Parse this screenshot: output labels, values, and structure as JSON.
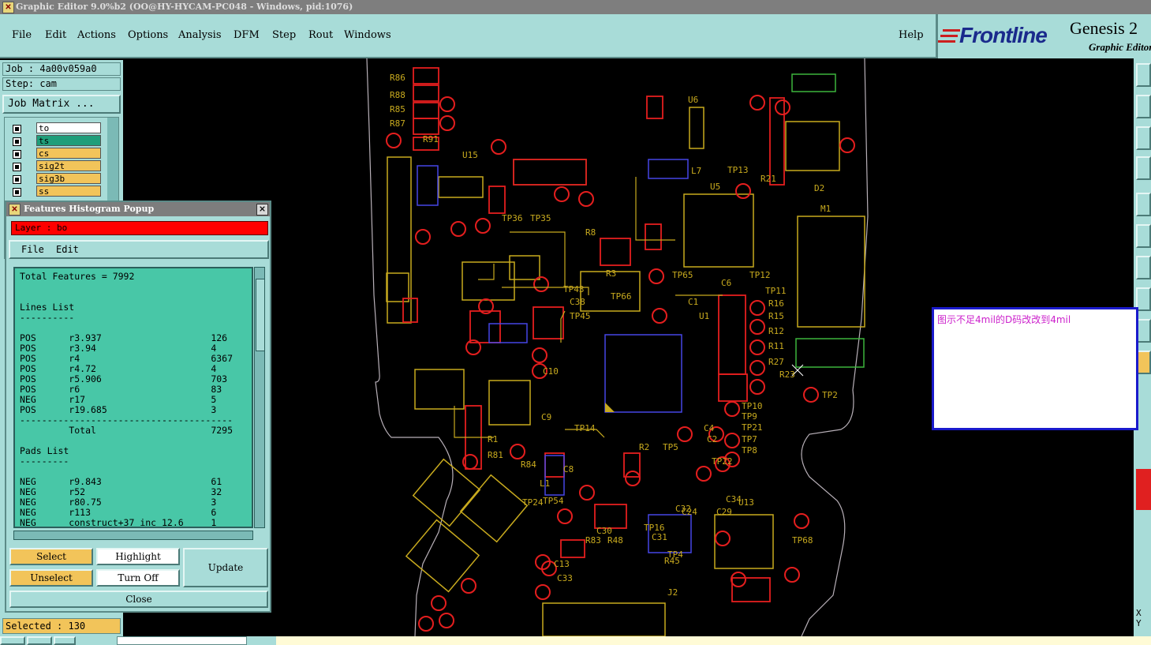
{
  "window": {
    "title": "Graphic Editor 9.0%b2 (OO@HY-HYCAM-PC048 - Windows, pid:1076)"
  },
  "menu": {
    "file": "File",
    "edit": "Edit",
    "actions": "Actions",
    "options": "Options",
    "analysis": "Analysis",
    "dfm": "DFM",
    "step": "Step",
    "rout": "Rout",
    "windows": "Windows",
    "help": "Help"
  },
  "brand": {
    "logo": "Frontline",
    "product": "Genesis 2",
    "subtitle": "Graphic Editor"
  },
  "job": {
    "job": "Job : 4a00v059a0",
    "step": "Step: cam",
    "matrix_button": "Job Matrix ..."
  },
  "layers": [
    {
      "name": "to",
      "color": "#ffffff"
    },
    {
      "name": "ts",
      "color": "#1f9e7a"
    },
    {
      "name": "cs",
      "color": "#f2c45a"
    },
    {
      "name": "sig2t",
      "color": "#f2c45a"
    },
    {
      "name": "sig3b",
      "color": "#f2c45a"
    },
    {
      "name": "ss",
      "color": "#f2c45a"
    }
  ],
  "popup": {
    "title": "Features Histogram Popup",
    "layer": "Layer :  bo",
    "menu_file": "File",
    "menu_edit": "Edit",
    "histogram": [
      "Total Features = 7992",
      "",
      "",
      "Lines List",
      "----------",
      "",
      "POS      r3.937                    126",
      "POS      r3.94                     4",
      "POS      r4                        6367",
      "POS      r4.72                     4",
      "POS      r5.906                    703",
      "POS      r6                        83",
      "NEG      r17                       5",
      "POS      r19.685                   3",
      "---------------------------------------",
      "         Total                     7295",
      "",
      "Pads List",
      "---------",
      "",
      "NEG      r9.843                    61",
      "NEG      r52                       32",
      "NEG      r80.75                    3",
      "NEG      r113                      6",
      "NEG      construct+37_inc_12.6     1"
    ],
    "buttons": {
      "select": "Select",
      "highlight": "Highlight",
      "update": "Update",
      "unselect": "Unselect",
      "turn_off": "Turn Off",
      "close": "Close"
    }
  },
  "status": {
    "selected": "Selected : 130"
  },
  "annotation": {
    "text": "图示不足4mil的D码改改到4mil"
  },
  "colors": {
    "panel": "#a8dcd8",
    "board_line": "#c8aa1e",
    "pad_red": "#e41e1e",
    "component_green": "#3cb43c",
    "component_blue": "#4646e6",
    "layer_highlight": "#ff0000",
    "selected_orange": "#f2c45a",
    "annotation_border": "#1a1acc",
    "annotation_text": "#cc22cc"
  },
  "pcb_labels": [
    "R86",
    "R88",
    "R85",
    "R87",
    "R91",
    "U15",
    "U6",
    "U5",
    "L7",
    "TP13",
    "R21",
    "D2",
    "M1",
    "TP35",
    "TP36",
    "R8",
    "TP12",
    "TP11",
    "R16",
    "R15",
    "R12",
    "R11",
    "R27",
    "R23",
    "TP2",
    "U1",
    "TP65",
    "TP66",
    "TP43",
    "TP45",
    "C38",
    "R3",
    "TP10",
    "TP9",
    "TP21",
    "TP7",
    "TP8",
    "C2",
    "C4",
    "TP22",
    "C34",
    "U13",
    "TP68",
    "TP4",
    "TP5",
    "R2",
    "R1",
    "R81",
    "R84",
    "TP24",
    "TP14",
    "C9",
    "C10",
    "C13",
    "C33",
    "R83",
    "R48",
    "R45",
    "TP54",
    "TP16",
    "C31",
    "C32",
    "C24",
    "C29",
    "C30",
    "L1",
    "J2",
    "C8",
    "C6",
    "C1"
  ]
}
